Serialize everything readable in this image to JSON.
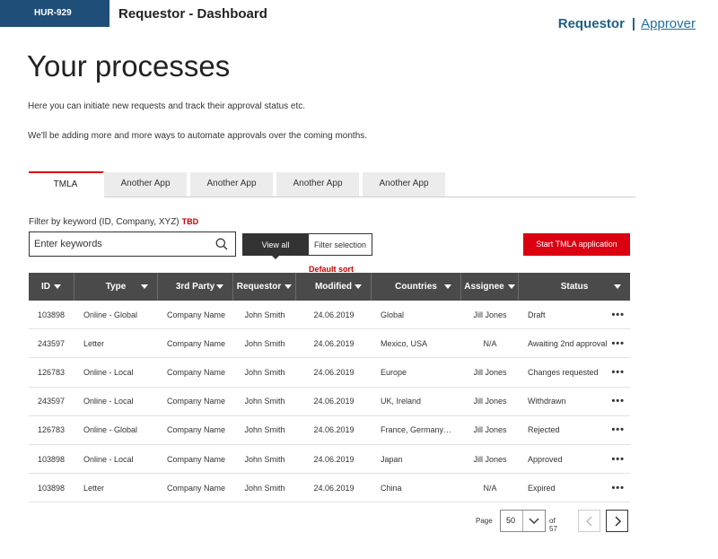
{
  "header": {
    "ticket": "HUR-929",
    "app_title": "Requestor - Dashboard",
    "role_nav": {
      "requestor": "Requestor",
      "separator": "|",
      "approver": "Approver"
    }
  },
  "page": {
    "title": "Your processes",
    "intro_line1": "Here you can initiate new requests and track their approval status etc.",
    "intro_line2": "We'll be adding more and more ways to automate approvals over the coming months."
  },
  "tabs": [
    "TMLA",
    "Another App",
    "Another App",
    "Another App",
    "Another App"
  ],
  "filter": {
    "label": "Filter by keyword (ID, Company, XYZ)",
    "tbd": "TBD",
    "placeholder": "Enter keywords",
    "view_all": "View all",
    "filter_selection": "Filter selection",
    "start_button": "Start TMLA application",
    "default_sort": "Default sort"
  },
  "table": {
    "columns": [
      "ID",
      "Type",
      "3rd Party",
      "Requestor",
      "Modified",
      "Countries",
      "Assignee",
      "Status"
    ],
    "rows": [
      [
        "103898",
        "Online - Global",
        "Company Name",
        "John Smith",
        "24.06.2019",
        "Global",
        "Jill Jones",
        "Draft"
      ],
      [
        "243597",
        "Letter",
        "Company Name",
        "John Smith",
        "24.06.2019",
        "Mexico, USA",
        "N/A",
        "Awaiting 2nd approval"
      ],
      [
        "126783",
        "Online - Local",
        "Company Name",
        "John Smith",
        "24.06.2019",
        "Europe",
        "Jill Jones",
        "Changes requested"
      ],
      [
        "243597",
        "Online - Local",
        "Company Name",
        "John Smith",
        "24.06.2019",
        "UK, Ireland",
        "Jill Jones",
        "Withdrawn"
      ],
      [
        "126783",
        "Online - Global",
        "Company Name",
        "John Smith",
        "24.06.2019",
        "France, Germany…",
        "Jill Jones",
        "Rejected"
      ],
      [
        "103898",
        "Online - Local",
        "Company Name",
        "John Smith",
        "24.06.2019",
        "Japan",
        "Jill Jones",
        "Approved"
      ],
      [
        "103898",
        "Letter",
        "Company Name",
        "John Smith",
        "24.06.2019",
        "China",
        "N/A",
        "Expired"
      ]
    ],
    "row_menu_icon": "•••"
  },
  "pagination": {
    "label": "Page",
    "page_size": "50",
    "of_total": "of 57"
  },
  "colors": {
    "brand_blue": "#1f4e79",
    "accent_red": "#db0011",
    "header_dark": "#4a4a4a"
  }
}
